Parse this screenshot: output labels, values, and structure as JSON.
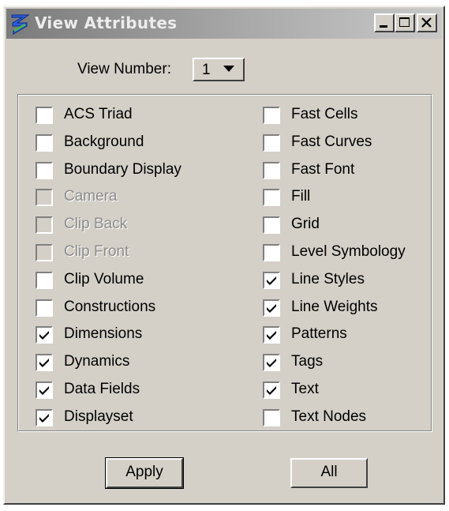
{
  "window": {
    "title": "View Attributes",
    "title_icon": "microstation-logo-icon",
    "controls": [
      "minimize-icon",
      "maximize-icon",
      "close-icon"
    ]
  },
  "view_number": {
    "label": "View Number:",
    "value": "1"
  },
  "attributes_left": [
    {
      "label": "ACS Triad",
      "checked": false,
      "disabled": false
    },
    {
      "label": "Background",
      "checked": false,
      "disabled": false
    },
    {
      "label": "Boundary Display",
      "checked": false,
      "disabled": false
    },
    {
      "label": "Camera",
      "checked": false,
      "disabled": true
    },
    {
      "label": "Clip Back",
      "checked": false,
      "disabled": true
    },
    {
      "label": "Clip Front",
      "checked": false,
      "disabled": true
    },
    {
      "label": "Clip Volume",
      "checked": false,
      "disabled": false
    },
    {
      "label": "Constructions",
      "checked": false,
      "disabled": false
    },
    {
      "label": "Dimensions",
      "checked": true,
      "disabled": false
    },
    {
      "label": "Dynamics",
      "checked": true,
      "disabled": false
    },
    {
      "label": "Data Fields",
      "checked": true,
      "disabled": false
    },
    {
      "label": "Displayset",
      "checked": true,
      "disabled": false
    }
  ],
  "attributes_right": [
    {
      "label": "Fast Cells",
      "checked": false,
      "disabled": false
    },
    {
      "label": "Fast Curves",
      "checked": false,
      "disabled": false
    },
    {
      "label": "Fast Font",
      "checked": false,
      "disabled": false
    },
    {
      "label": "Fill",
      "checked": false,
      "disabled": false
    },
    {
      "label": "Grid",
      "checked": false,
      "disabled": false
    },
    {
      "label": "Level Symbology",
      "checked": false,
      "disabled": false
    },
    {
      "label": "Line Styles",
      "checked": true,
      "disabled": false
    },
    {
      "label": "Line Weights",
      "checked": true,
      "disabled": false
    },
    {
      "label": "Patterns",
      "checked": true,
      "disabled": false
    },
    {
      "label": "Tags",
      "checked": true,
      "disabled": false
    },
    {
      "label": "Text",
      "checked": true,
      "disabled": false
    },
    {
      "label": "Text Nodes",
      "checked": false,
      "disabled": false
    }
  ],
  "buttons": {
    "apply": "Apply",
    "all": "All"
  },
  "colors": {
    "dialog_bg": "#d4d0c8",
    "titlebar_inactive": "#808080"
  }
}
